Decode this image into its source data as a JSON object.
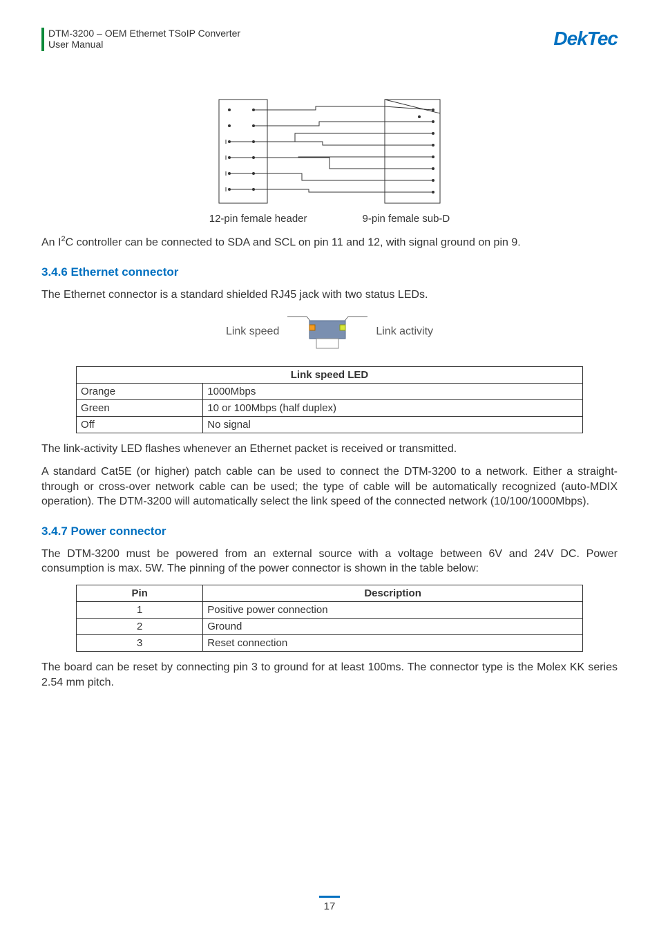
{
  "header": {
    "line1": "DTM-3200 – OEM Ethernet TSoIP Converter",
    "line2": "User Manual",
    "logo": "DekTec"
  },
  "diagram_caption": {
    "left": "12-pin female header",
    "right": "9-pin female sub-D"
  },
  "i2c_para_prefix": "An I",
  "i2c_para_sup": "2",
  "i2c_para_rest": "C controller can be connected to SDA and SCL on pin 11 and 12, with signal ground on pin 9.",
  "sec_eth": {
    "heading": "3.4.6 Ethernet connector",
    "intro": "The Ethernet connector is a standard shielded RJ45 jack with two status LEDs.",
    "label_left": "Link speed",
    "label_right": "Link activity"
  },
  "led_table": {
    "header": "Link speed LED",
    "rows": [
      {
        "c0": "Orange",
        "c1": "1000Mbps"
      },
      {
        "c0": "Green",
        "c1": "10 or 100Mbps (half duplex)"
      },
      {
        "c0": "Off",
        "c1": "No signal"
      }
    ]
  },
  "para_link_activity": "The link-activity LED flashes whenever an Ethernet packet is received or transmitted.",
  "para_cat5e": "A standard Cat5E (or higher) patch cable can be used to connect the DTM-3200 to a network. Either a straight-through or cross-over network cable can be used; the type of cable will be automatically recognized (auto-MDIX operation). The DTM-3200 will automatically select the link speed of the connected network (10/100/1000Mbps).",
  "sec_pwr": {
    "heading": "3.4.7 Power connector",
    "intro": "The DTM-3200 must be powered from an external source with a voltage between 6V and 24V DC. Power consumption is max. 5W. The pinning of the power connector is shown in the table below:"
  },
  "pin_table": {
    "h0": "Pin",
    "h1": "Description",
    "rows": [
      {
        "pin": "1",
        "desc": "Positive power connection"
      },
      {
        "pin": "2",
        "desc": "Ground"
      },
      {
        "pin": "3",
        "desc": "Reset connection"
      }
    ]
  },
  "para_reset": "The board can be reset by connecting pin 3 to ground for at least 100ms. The connector type is the Molex KK series 2.54 mm pitch.",
  "page_number": "17"
}
